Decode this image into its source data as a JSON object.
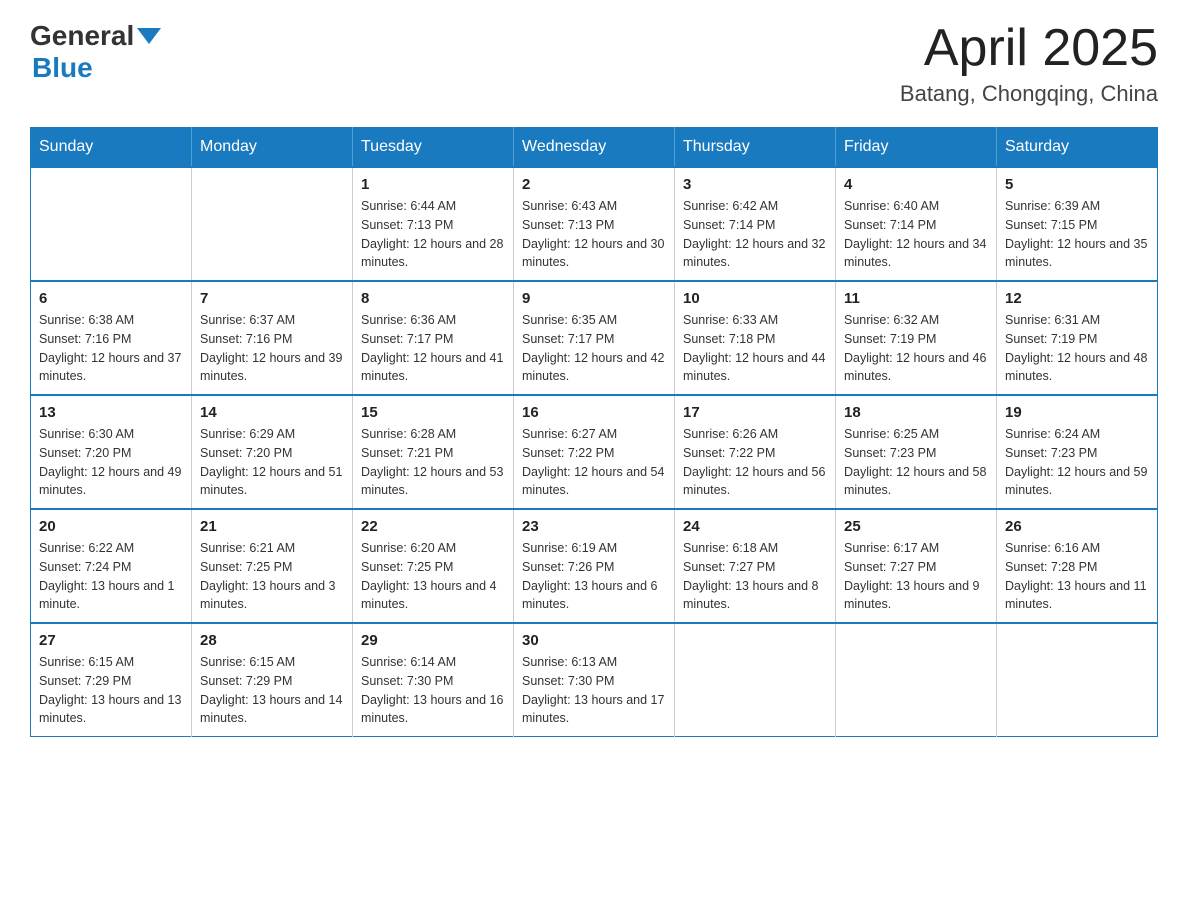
{
  "header": {
    "logo_general": "General",
    "logo_blue": "Blue",
    "month_title": "April 2025",
    "location": "Batang, Chongqing, China"
  },
  "weekdays": [
    "Sunday",
    "Monday",
    "Tuesday",
    "Wednesday",
    "Thursday",
    "Friday",
    "Saturday"
  ],
  "weeks": [
    [
      {
        "day": "",
        "sunrise": "",
        "sunset": "",
        "daylight": ""
      },
      {
        "day": "",
        "sunrise": "",
        "sunset": "",
        "daylight": ""
      },
      {
        "day": "1",
        "sunrise": "Sunrise: 6:44 AM",
        "sunset": "Sunset: 7:13 PM",
        "daylight": "Daylight: 12 hours and 28 minutes."
      },
      {
        "day": "2",
        "sunrise": "Sunrise: 6:43 AM",
        "sunset": "Sunset: 7:13 PM",
        "daylight": "Daylight: 12 hours and 30 minutes."
      },
      {
        "day": "3",
        "sunrise": "Sunrise: 6:42 AM",
        "sunset": "Sunset: 7:14 PM",
        "daylight": "Daylight: 12 hours and 32 minutes."
      },
      {
        "day": "4",
        "sunrise": "Sunrise: 6:40 AM",
        "sunset": "Sunset: 7:14 PM",
        "daylight": "Daylight: 12 hours and 34 minutes."
      },
      {
        "day": "5",
        "sunrise": "Sunrise: 6:39 AM",
        "sunset": "Sunset: 7:15 PM",
        "daylight": "Daylight: 12 hours and 35 minutes."
      }
    ],
    [
      {
        "day": "6",
        "sunrise": "Sunrise: 6:38 AM",
        "sunset": "Sunset: 7:16 PM",
        "daylight": "Daylight: 12 hours and 37 minutes."
      },
      {
        "day": "7",
        "sunrise": "Sunrise: 6:37 AM",
        "sunset": "Sunset: 7:16 PM",
        "daylight": "Daylight: 12 hours and 39 minutes."
      },
      {
        "day": "8",
        "sunrise": "Sunrise: 6:36 AM",
        "sunset": "Sunset: 7:17 PM",
        "daylight": "Daylight: 12 hours and 41 minutes."
      },
      {
        "day": "9",
        "sunrise": "Sunrise: 6:35 AM",
        "sunset": "Sunset: 7:17 PM",
        "daylight": "Daylight: 12 hours and 42 minutes."
      },
      {
        "day": "10",
        "sunrise": "Sunrise: 6:33 AM",
        "sunset": "Sunset: 7:18 PM",
        "daylight": "Daylight: 12 hours and 44 minutes."
      },
      {
        "day": "11",
        "sunrise": "Sunrise: 6:32 AM",
        "sunset": "Sunset: 7:19 PM",
        "daylight": "Daylight: 12 hours and 46 minutes."
      },
      {
        "day": "12",
        "sunrise": "Sunrise: 6:31 AM",
        "sunset": "Sunset: 7:19 PM",
        "daylight": "Daylight: 12 hours and 48 minutes."
      }
    ],
    [
      {
        "day": "13",
        "sunrise": "Sunrise: 6:30 AM",
        "sunset": "Sunset: 7:20 PM",
        "daylight": "Daylight: 12 hours and 49 minutes."
      },
      {
        "day": "14",
        "sunrise": "Sunrise: 6:29 AM",
        "sunset": "Sunset: 7:20 PM",
        "daylight": "Daylight: 12 hours and 51 minutes."
      },
      {
        "day": "15",
        "sunrise": "Sunrise: 6:28 AM",
        "sunset": "Sunset: 7:21 PM",
        "daylight": "Daylight: 12 hours and 53 minutes."
      },
      {
        "day": "16",
        "sunrise": "Sunrise: 6:27 AM",
        "sunset": "Sunset: 7:22 PM",
        "daylight": "Daylight: 12 hours and 54 minutes."
      },
      {
        "day": "17",
        "sunrise": "Sunrise: 6:26 AM",
        "sunset": "Sunset: 7:22 PM",
        "daylight": "Daylight: 12 hours and 56 minutes."
      },
      {
        "day": "18",
        "sunrise": "Sunrise: 6:25 AM",
        "sunset": "Sunset: 7:23 PM",
        "daylight": "Daylight: 12 hours and 58 minutes."
      },
      {
        "day": "19",
        "sunrise": "Sunrise: 6:24 AM",
        "sunset": "Sunset: 7:23 PM",
        "daylight": "Daylight: 12 hours and 59 minutes."
      }
    ],
    [
      {
        "day": "20",
        "sunrise": "Sunrise: 6:22 AM",
        "sunset": "Sunset: 7:24 PM",
        "daylight": "Daylight: 13 hours and 1 minute."
      },
      {
        "day": "21",
        "sunrise": "Sunrise: 6:21 AM",
        "sunset": "Sunset: 7:25 PM",
        "daylight": "Daylight: 13 hours and 3 minutes."
      },
      {
        "day": "22",
        "sunrise": "Sunrise: 6:20 AM",
        "sunset": "Sunset: 7:25 PM",
        "daylight": "Daylight: 13 hours and 4 minutes."
      },
      {
        "day": "23",
        "sunrise": "Sunrise: 6:19 AM",
        "sunset": "Sunset: 7:26 PM",
        "daylight": "Daylight: 13 hours and 6 minutes."
      },
      {
        "day": "24",
        "sunrise": "Sunrise: 6:18 AM",
        "sunset": "Sunset: 7:27 PM",
        "daylight": "Daylight: 13 hours and 8 minutes."
      },
      {
        "day": "25",
        "sunrise": "Sunrise: 6:17 AM",
        "sunset": "Sunset: 7:27 PM",
        "daylight": "Daylight: 13 hours and 9 minutes."
      },
      {
        "day": "26",
        "sunrise": "Sunrise: 6:16 AM",
        "sunset": "Sunset: 7:28 PM",
        "daylight": "Daylight: 13 hours and 11 minutes."
      }
    ],
    [
      {
        "day": "27",
        "sunrise": "Sunrise: 6:15 AM",
        "sunset": "Sunset: 7:29 PM",
        "daylight": "Daylight: 13 hours and 13 minutes."
      },
      {
        "day": "28",
        "sunrise": "Sunrise: 6:15 AM",
        "sunset": "Sunset: 7:29 PM",
        "daylight": "Daylight: 13 hours and 14 minutes."
      },
      {
        "day": "29",
        "sunrise": "Sunrise: 6:14 AM",
        "sunset": "Sunset: 7:30 PM",
        "daylight": "Daylight: 13 hours and 16 minutes."
      },
      {
        "day": "30",
        "sunrise": "Sunrise: 6:13 AM",
        "sunset": "Sunset: 7:30 PM",
        "daylight": "Daylight: 13 hours and 17 minutes."
      },
      {
        "day": "",
        "sunrise": "",
        "sunset": "",
        "daylight": ""
      },
      {
        "day": "",
        "sunrise": "",
        "sunset": "",
        "daylight": ""
      },
      {
        "day": "",
        "sunrise": "",
        "sunset": "",
        "daylight": ""
      }
    ]
  ]
}
